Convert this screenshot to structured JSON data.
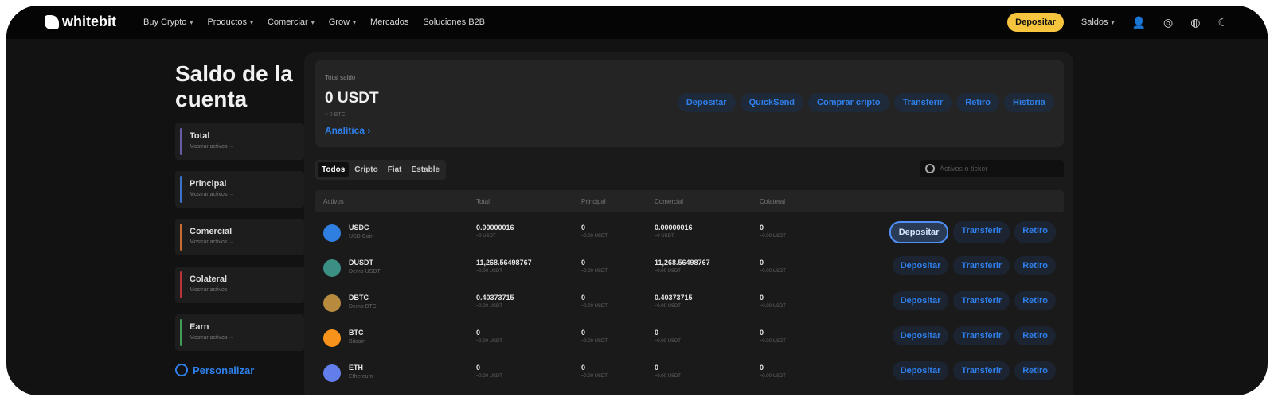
{
  "brand": {
    "name": "whitebit"
  },
  "nav": {
    "items": [
      {
        "label": "Buy Crypto"
      },
      {
        "label": "Productos"
      },
      {
        "label": "Comerciar"
      },
      {
        "label": "Grow"
      },
      {
        "label": "Mercados"
      },
      {
        "label": "Soluciones B2B"
      }
    ],
    "deposit_label": "Depositar",
    "balances_label": "Saldos"
  },
  "sidebar": {
    "title": "Saldo de la cuenta",
    "cards": [
      {
        "label": "Total",
        "sub": "Mostrar activos →",
        "color": "#6b5aa6"
      },
      {
        "label": "Principal",
        "sub": "Mostrar activos →",
        "color": "#3b73c8"
      },
      {
        "label": "Comercial",
        "sub": "Mostrar activos →",
        "color": "#c86b2e"
      },
      {
        "label": "Colateral",
        "sub": "Mostrar activos →",
        "color": "#b8333a"
      },
      {
        "label": "Earn",
        "sub": "Mostrar activos →",
        "color": "#3f9b55"
      }
    ],
    "personalize_label": "Personalizar"
  },
  "balance": {
    "label": "Total saldo",
    "amount": "0 USDT",
    "btc": "≈ 0 BTC",
    "analytics_label": "Analítica",
    "actions": [
      "Depositar",
      "QuickSend",
      "Comprar cripto",
      "Transferir",
      "Retiro",
      "Historia"
    ]
  },
  "filters": [
    "Todos",
    "Cripto",
    "Fiat",
    "Estable"
  ],
  "search": {
    "placeholder": "Activos o ticker"
  },
  "table": {
    "headers": [
      "Activos",
      "Total",
      "Principal",
      "Comercial",
      "Colateral"
    ],
    "rows": [
      {
        "symbol": "USDC",
        "name": "USD Coin",
        "total": "0.00000016",
        "total_sub": "≈0 USDT",
        "principal": "0",
        "principal_sub": "≈0.00 USDT",
        "comercial": "0.00000016",
        "comercial_sub": "≈0 USDT",
        "colateral": "0",
        "colateral_sub": "≈0.00 USDT",
        "color": "#2f7fe0"
      },
      {
        "symbol": "DUSDT",
        "name": "Demo USDT",
        "total": "11,268.56498767",
        "total_sub": "≈0.00 USDT",
        "principal": "0",
        "principal_sub": "≈0.00 USDT",
        "comercial": "11,268.56498767",
        "comercial_sub": "≈0.00 USDT",
        "colateral": "0",
        "colateral_sub": "≈0.00 USDT",
        "color": "#3c8f84"
      },
      {
        "symbol": "DBTC",
        "name": "Demo BTC",
        "total": "0.40373715",
        "total_sub": "≈0.00 USDT",
        "principal": "0",
        "principal_sub": "≈0.00 USDT",
        "comercial": "0.40373715",
        "comercial_sub": "≈0.00 USDT",
        "colateral": "0",
        "colateral_sub": "≈0.00 USDT",
        "color": "#b88a3e"
      },
      {
        "symbol": "BTC",
        "name": "Bitcoin",
        "total": "0",
        "total_sub": "≈0.00 USDT",
        "principal": "0",
        "principal_sub": "≈0.00 USDT",
        "comercial": "0",
        "comercial_sub": "≈0.00 USDT",
        "colateral": "0",
        "colateral_sub": "≈0.00 USDT",
        "color": "#f7931a"
      },
      {
        "symbol": "ETH",
        "name": "Ethereum",
        "total": "0",
        "total_sub": "≈0.00 USDT",
        "principal": "0",
        "principal_sub": "≈0.00 USDT",
        "comercial": "0",
        "comercial_sub": "≈0.00 USDT",
        "colateral": "0",
        "colateral_sub": "≈0.00 USDT",
        "color": "#627eea"
      }
    ],
    "row_actions": [
      "Depositar",
      "Transferir",
      "Retiro"
    ]
  }
}
